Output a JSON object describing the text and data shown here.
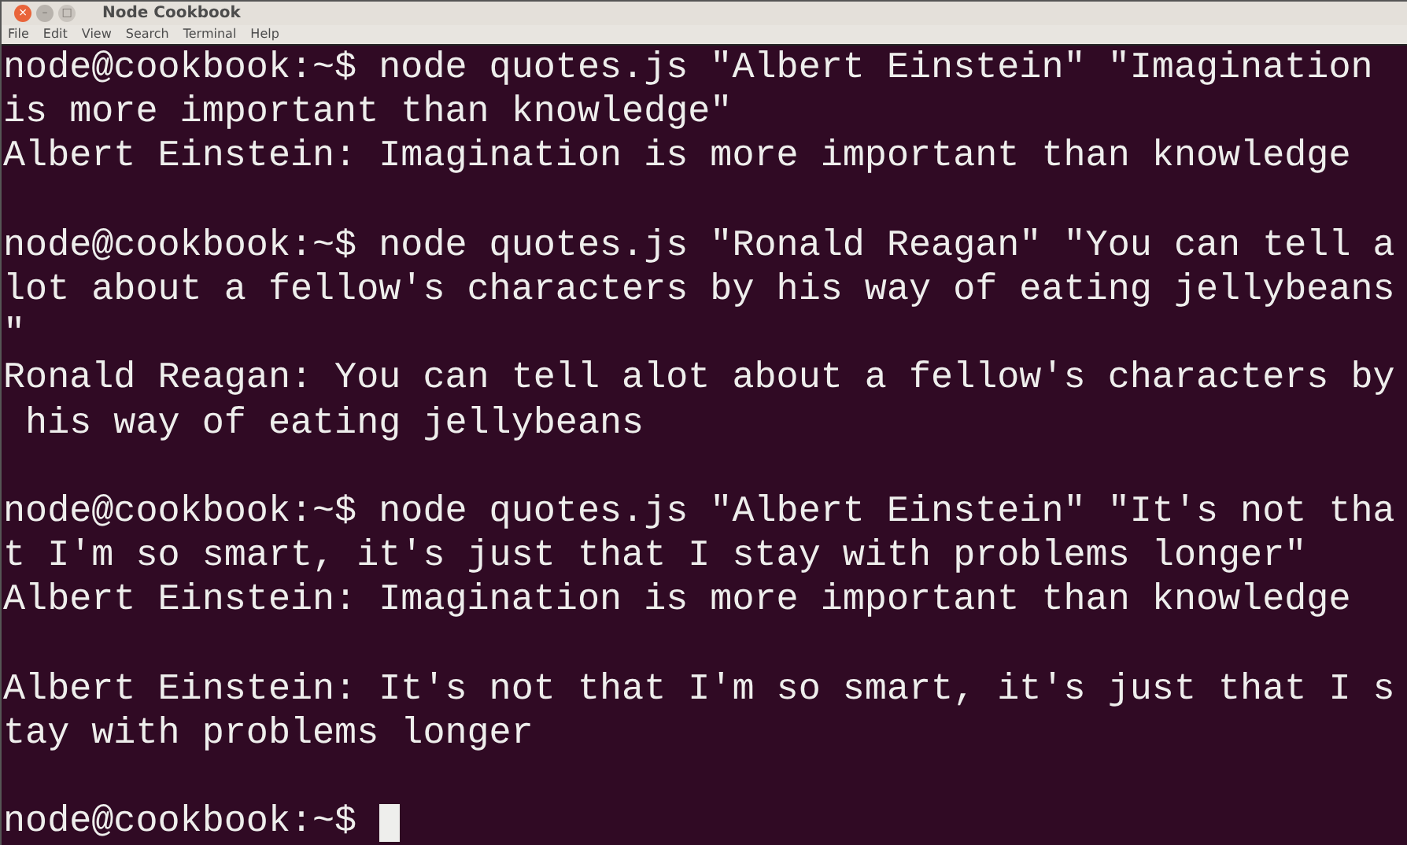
{
  "window": {
    "title": "Node Cookbook",
    "controls": [
      "×",
      "–",
      "□"
    ]
  },
  "menu": [
    "File",
    "Edit",
    "View",
    "Search",
    "Terminal",
    "Help"
  ],
  "terminal": {
    "lines": [
      {
        "kind": "text",
        "text": "node@cookbook:~$ node quotes.js \"Albert Einstein\" \"Imagination"
      },
      {
        "kind": "text",
        "text": "is more important than knowledge\""
      },
      {
        "kind": "text",
        "text": "Albert Einstein: Imagination is more important than knowledge"
      },
      {
        "kind": "blank"
      },
      {
        "kind": "text",
        "text": "node@cookbook:~$ node quotes.js \"Ronald Reagan\" \"You can tell a"
      },
      {
        "kind": "text",
        "text": "lot about a fellow's characters by his way of eating jellybeans"
      },
      {
        "kind": "text",
        "text": "\""
      },
      {
        "kind": "text",
        "text": "Ronald Reagan: You can tell alot about a fellow's characters by"
      },
      {
        "kind": "text",
        "text": " his way of eating jellybeans"
      },
      {
        "kind": "blank"
      },
      {
        "kind": "text",
        "text": "node@cookbook:~$ node quotes.js \"Albert Einstein\" \"It's not tha"
      },
      {
        "kind": "text",
        "text": "t I'm so smart, it's just that I stay with problems longer\""
      },
      {
        "kind": "text",
        "text": "Albert Einstein: Imagination is more important than knowledge"
      },
      {
        "kind": "blank"
      },
      {
        "kind": "text",
        "text": "Albert Einstein: It's not that I'm so smart, it's just that I s"
      },
      {
        "kind": "text",
        "text": "tay with problems longer"
      },
      {
        "kind": "blank"
      },
      {
        "kind": "text",
        "text": "node@cookbook:~$",
        "cursor": true
      }
    ]
  }
}
